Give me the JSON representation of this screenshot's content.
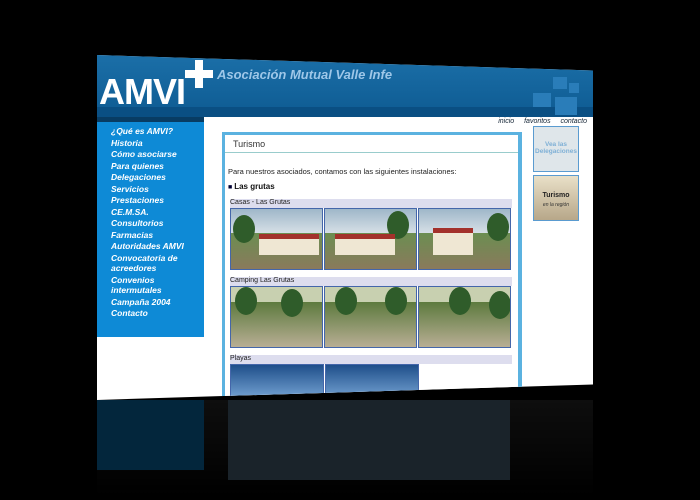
{
  "header": {
    "logo": "AMVI",
    "title": "Asociación Mutual Valle Infe"
  },
  "top_links": [
    "inicio",
    "favoritos",
    "contacto"
  ],
  "sidebar": {
    "items": [
      "¿Qué es AMVI?",
      "Historia",
      "Cómo asociarse",
      "Para quienes",
      "Delegaciones",
      "Servicios",
      "Prestaciones",
      "CE.M.SA.",
      "Consultorios",
      "Farmacias",
      "Autoridades AMVI",
      "Convocatoria de acreedores",
      "Convenios intermutales",
      "Campaña 2004",
      "Contacto"
    ]
  },
  "content": {
    "tab": "Turismo",
    "intro": "Para nuestros asociados, contamos con las siguientes instalaciones:",
    "heading": "Las grutas",
    "sections": [
      {
        "label": "Casas - Las Grutas"
      },
      {
        "label": "Camping Las Grutas"
      },
      {
        "label": "Playas"
      }
    ]
  },
  "right_panel": {
    "delegaciones": "Vea las Delegaciones",
    "turismo_title": "Turismo",
    "turismo_sub": "en la región"
  },
  "colors": {
    "header": "#1b6fa8",
    "sidebar": "#0e8ad6",
    "frame": "#5bb2e0",
    "background": "#000000"
  }
}
